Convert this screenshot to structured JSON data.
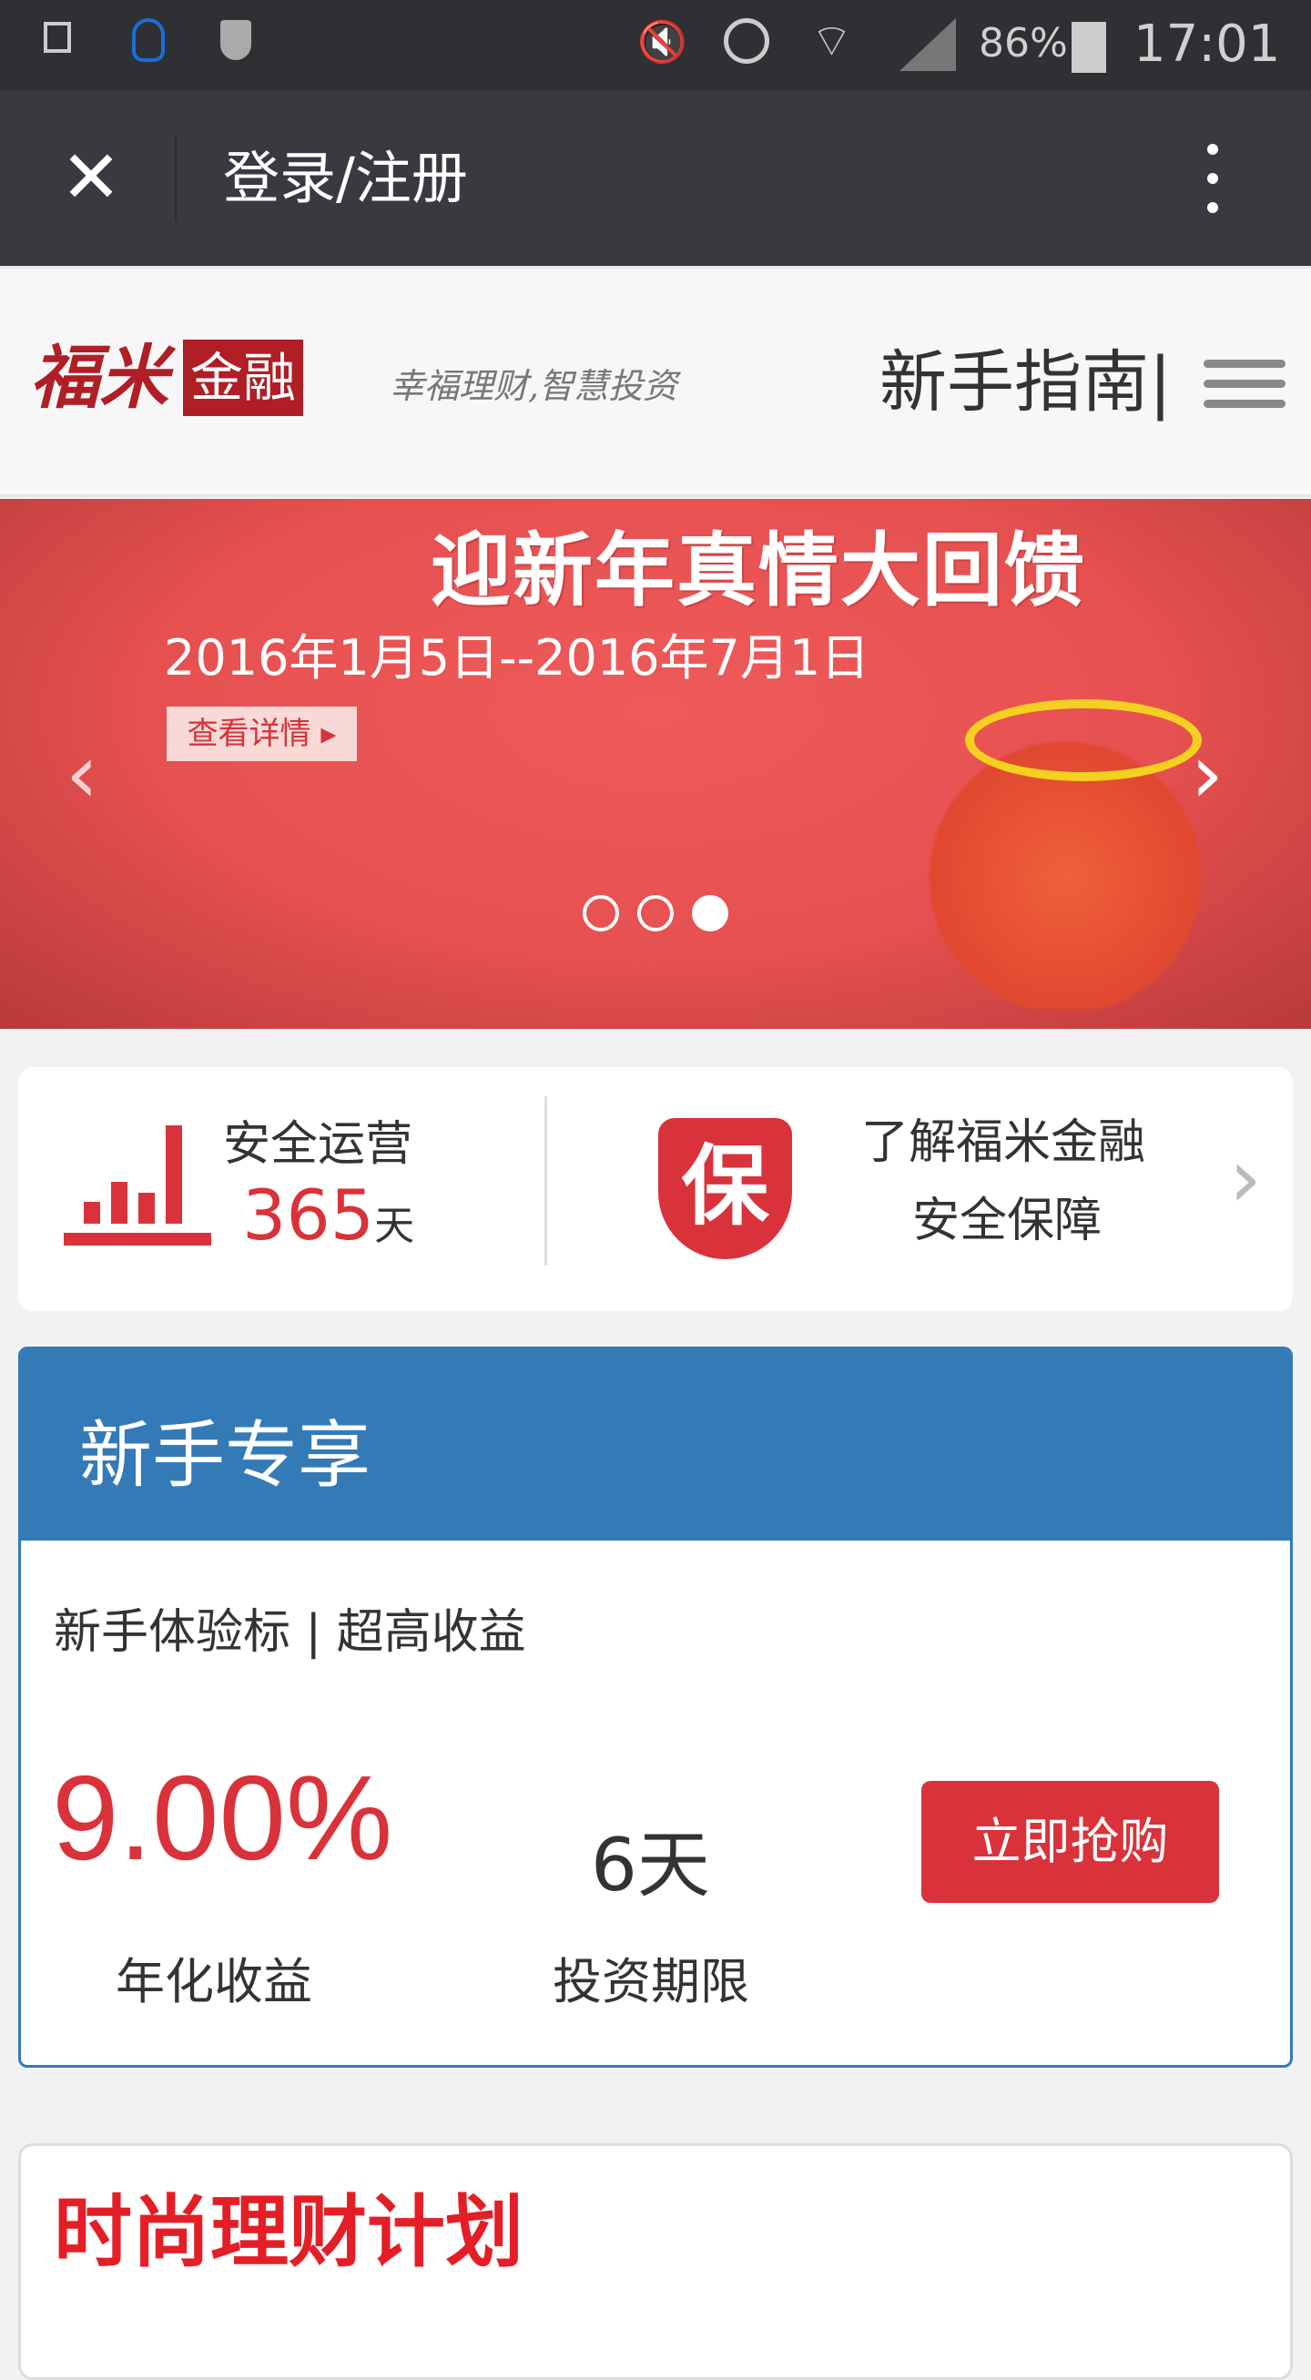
{
  "status_bar": {
    "battery": "86%",
    "time": "17:01"
  },
  "toolbar": {
    "title": "登录/注册"
  },
  "header": {
    "logo_main": "福米",
    "logo_box": "金融",
    "slogan": "幸福理财,智慧投资",
    "guide_link": "新手指南|"
  },
  "banner": {
    "title": "迎新年真情大回馈",
    "date_range": "2016年1月5日--2016年7月1日",
    "details_button": "查看详情 ▸",
    "slide_count": 3,
    "active_slide": 3
  },
  "safety": {
    "label": "安全运营",
    "days_value": "365",
    "days_unit": "天",
    "learn_line1": "了解福米金融",
    "learn_line2": "安全保障",
    "shield_char": "保"
  },
  "newbie": {
    "title": "新手专享",
    "product_name": "新手体验标 | 超高收益",
    "rate": "9.00%",
    "rate_label": "年化收益",
    "term": "6天",
    "term_label": "投资期限",
    "buy_button": "立即抢购"
  },
  "promo": {
    "title": "时尚理财计划"
  },
  "colors": {
    "accent_red": "#d9323a",
    "newbie_blue": "#347ab7",
    "toolbar": "#393a3f"
  }
}
